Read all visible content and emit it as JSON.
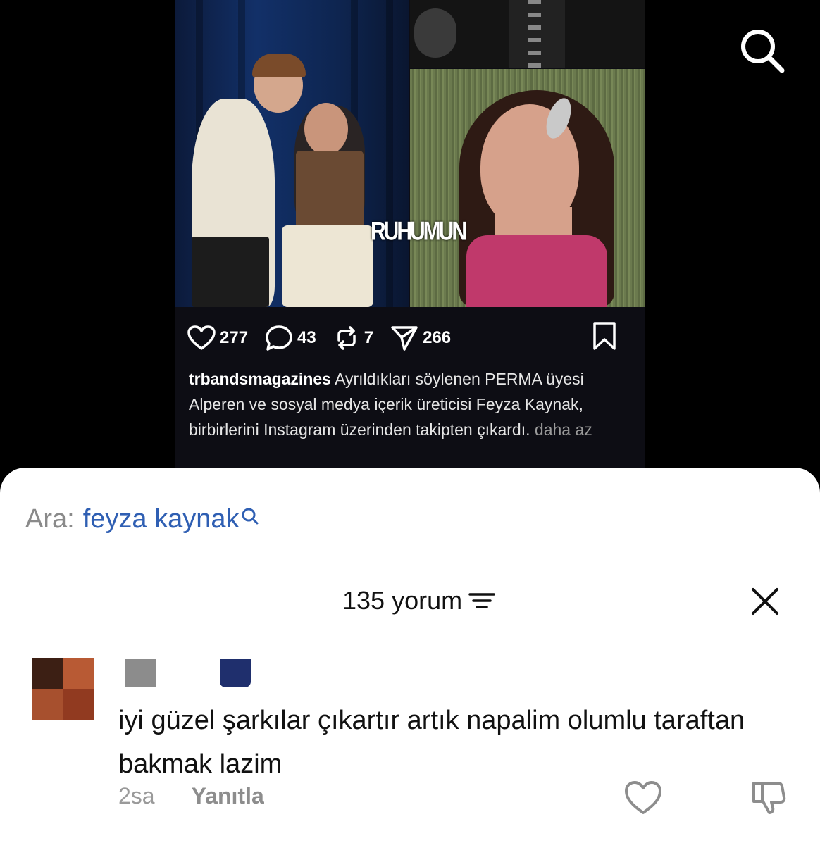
{
  "post": {
    "watermark": "RUHUMUN",
    "metrics": {
      "likes": "277",
      "comments": "43",
      "reposts": "7",
      "shares": "266"
    },
    "caption": {
      "username": "trbandsmagazines",
      "text": " Ayrıldıkları söylenen PERMA üyesi Alperen ve sosyal medya içerik üreticisi Feyza Kaynak, birbirlerini Instagram üzerinden takipten çıkardı.",
      "less_label": " daha az"
    }
  },
  "icons": {
    "search": "search-icon",
    "heart": "heart-icon",
    "comment": "comment-icon",
    "repost": "repost-icon",
    "share": "send-icon",
    "bookmark": "bookmark-icon",
    "sort": "sort-icon",
    "close": "close-icon",
    "like": "heart-icon",
    "dislike": "thumbs-down-icon"
  },
  "sheet": {
    "search_prefix": "Ara:",
    "search_query": "feyza kaynak",
    "comment_count": "135 yorum"
  },
  "comment": {
    "text": "iyi güzel şarkılar çıkartır artık napalim olumlu taraftan bakmak lazim",
    "time": "2sa",
    "reply_label": "Yanıtla"
  },
  "colors": {
    "link_blue": "#2f5fb3",
    "muted_gray": "#8a8a8a"
  }
}
